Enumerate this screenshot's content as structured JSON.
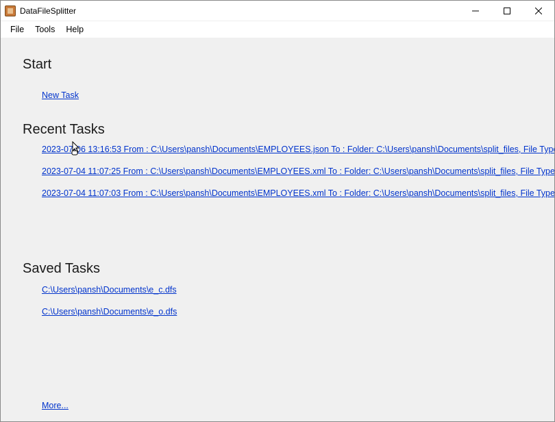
{
  "window": {
    "title": "DataFileSplitter"
  },
  "menu": {
    "file": "File",
    "tools": "Tools",
    "help": "Help"
  },
  "sections": {
    "start": "Start",
    "recent": "Recent Tasks",
    "saved": "Saved Tasks"
  },
  "start": {
    "new_task": "New Task"
  },
  "recent_tasks": [
    "2023-07-06 13:16:53  From : C:\\Users\\pansh\\Documents\\EMPLOYEES.json To : Folder: C:\\Users\\pansh\\Documents\\split_files, File Type: Json, split",
    "2023-07-04 11:07:25  From : C:\\Users\\pansh\\Documents\\EMPLOYEES.xml To : Folder: C:\\Users\\pansh\\Documents\\split_files, File Type: Xml, split",
    "2023-07-04 11:07:03  From : C:\\Users\\pansh\\Documents\\EMPLOYEES.xml To : Folder: C:\\Users\\pansh\\Documents\\split_files, File Type: Xml, split"
  ],
  "saved_tasks": [
    "C:\\Users\\pansh\\Documents\\e_c.dfs",
    "C:\\Users\\pansh\\Documents\\e_o.dfs"
  ],
  "more": "More..."
}
